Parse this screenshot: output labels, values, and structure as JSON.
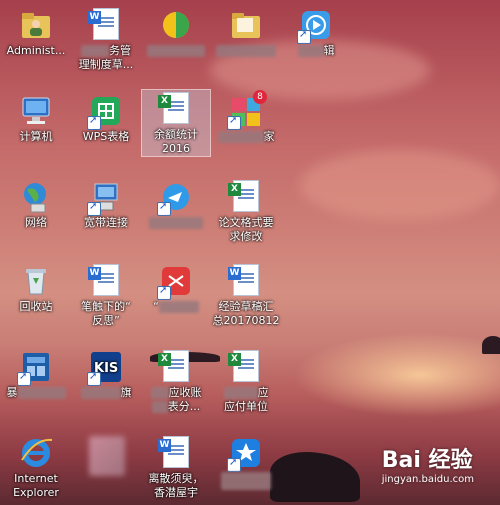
{
  "desktop": {
    "icons": {
      "administrator": {
        "label": "Administ..."
      },
      "doc_work": {
        "label_line1": "务管",
        "label_line2": "理制度草..."
      },
      "folder_c2": {
        "label": ""
      },
      "folder_c4": {
        "label": ""
      },
      "app_edit": {
        "label": "辑"
      },
      "computer": {
        "label": "计算机"
      },
      "wps": {
        "label": "WPS表格"
      },
      "excel_balance": {
        "label_line1": "余额统计",
        "label_line2": "2016"
      },
      "app_home": {
        "label": "家",
        "badge": "8"
      },
      "network": {
        "label": "网络"
      },
      "broadband": {
        "label": "宽带连接"
      },
      "app_bird": {
        "label": ""
      },
      "excel_thesis": {
        "label_line1": "论文格式要",
        "label_line2": "求修改"
      },
      "recycle": {
        "label": "回收站"
      },
      "doc_reflection": {
        "label_line1": "笔触下的“",
        "label_line2": "反思”"
      },
      "app_red": {
        "label": "“"
      },
      "doc_draft": {
        "label_line1": "经验草稿汇",
        "label_line2": "总20170812"
      },
      "app_blue": {
        "label": "暴"
      },
      "kis": {
        "label": "旗"
      },
      "excel_receivable": {
        "label_line1": "应收账",
        "label_line2": "表分..."
      },
      "excel_payable": {
        "label_line1": "应",
        "label_line2": "应付单位"
      },
      "ie": {
        "label_line1": "Internet",
        "label_line2": "Explorer"
      },
      "blur_app": {
        "label": ""
      },
      "doc_essay": {
        "label_line1": "离散须臾，",
        "label_line2": "香潜屋宇"
      },
      "app_star": {
        "label": ""
      }
    }
  },
  "watermark": {
    "main": "Bai 经验",
    "sub": "jingyan.baidu.com"
  }
}
